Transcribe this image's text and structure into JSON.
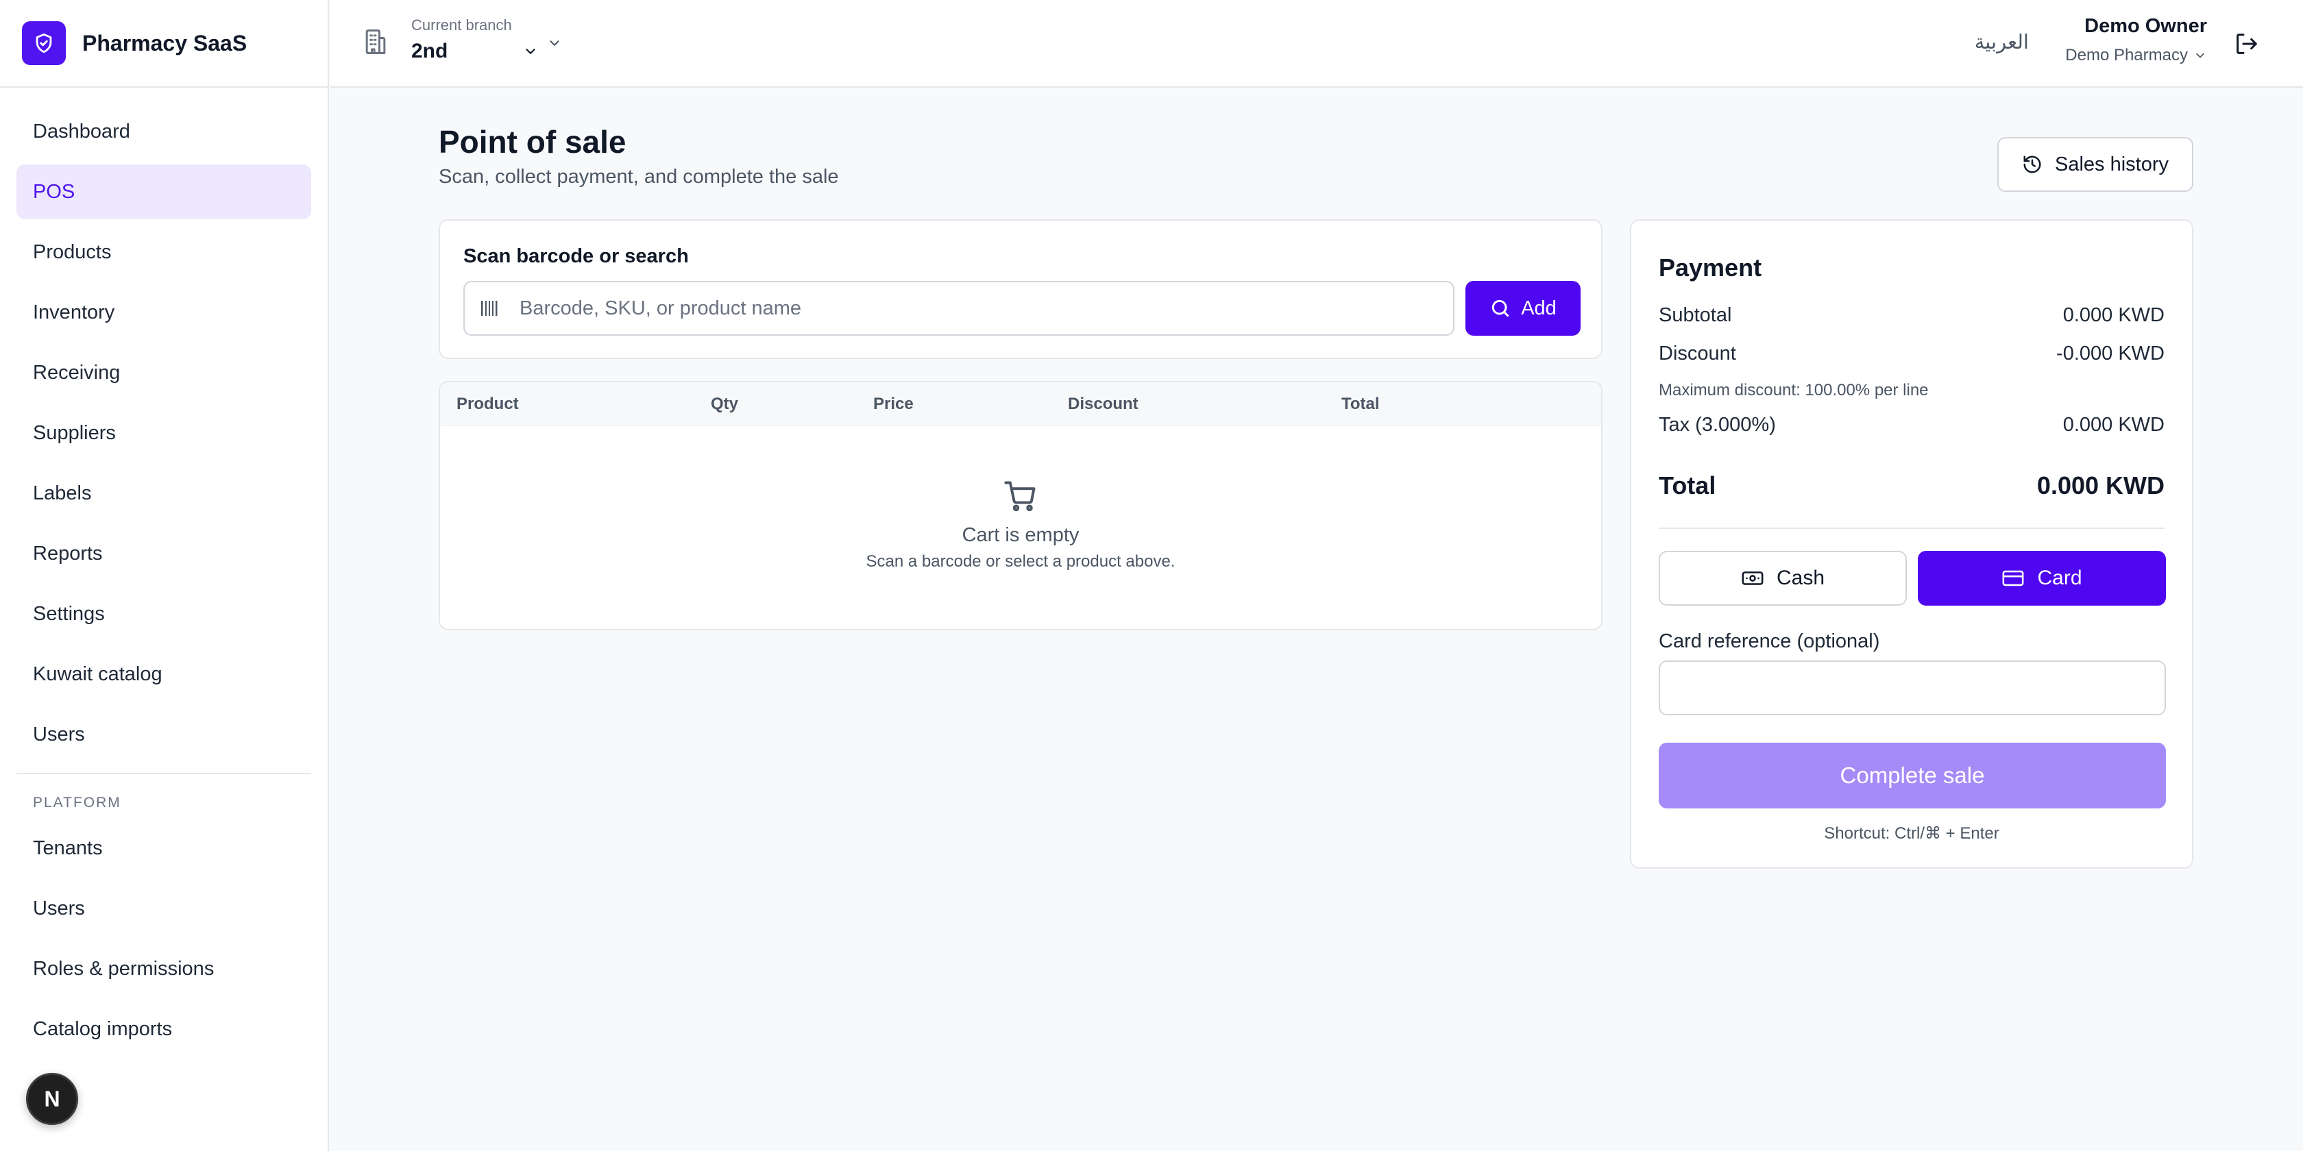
{
  "app": {
    "name": "Pharmacy SaaS"
  },
  "colors": {
    "accent": "#4f06f0",
    "accent_light": "#ede8fd",
    "complete_disabled": "#a58bf7"
  },
  "sidebar": {
    "items": [
      {
        "label": "Dashboard"
      },
      {
        "label": "POS",
        "active": true
      },
      {
        "label": "Products"
      },
      {
        "label": "Inventory"
      },
      {
        "label": "Receiving"
      },
      {
        "label": "Suppliers"
      },
      {
        "label": "Labels"
      },
      {
        "label": "Reports"
      },
      {
        "label": "Settings"
      },
      {
        "label": "Kuwait catalog"
      },
      {
        "label": "Users"
      }
    ],
    "platform_label": "PLATFORM",
    "platform_items": [
      {
        "label": "Tenants"
      },
      {
        "label": "Users"
      },
      {
        "label": "Roles & permissions"
      },
      {
        "label": "Catalog imports"
      }
    ],
    "badge": "N"
  },
  "topbar": {
    "branch_label": "Current branch",
    "branch_value": "2nd",
    "language": "العربية",
    "user_name": "Demo Owner",
    "user_org": "Demo Pharmacy"
  },
  "page": {
    "title": "Point of sale",
    "subtitle": "Scan, collect payment, and complete the sale",
    "history_button": "Sales history"
  },
  "scan": {
    "label": "Scan barcode or search",
    "placeholder": "Barcode, SKU, or product name",
    "add_button": "Add"
  },
  "cart": {
    "columns": [
      "Product",
      "Qty",
      "Price",
      "Discount",
      "Total"
    ],
    "empty_title": "Cart is empty",
    "empty_subtitle": "Scan a barcode or select a product above."
  },
  "payment": {
    "title": "Payment",
    "subtotal_label": "Subtotal",
    "subtotal_value": "0.000 KWD",
    "discount_label": "Discount",
    "discount_value": "-0.000 KWD",
    "max_discount_note": "Maximum discount: 100.00% per line",
    "tax_label": "Tax (3.000%)",
    "tax_value": "0.000 KWD",
    "total_label": "Total",
    "total_value": "0.000 KWD",
    "cash_label": "Cash",
    "card_label": "Card",
    "selected_method": "Card",
    "card_reference_label": "Card reference (optional)",
    "card_reference_value": "",
    "complete_button": "Complete sale",
    "shortcut": "Shortcut: Ctrl/⌘ + Enter"
  }
}
